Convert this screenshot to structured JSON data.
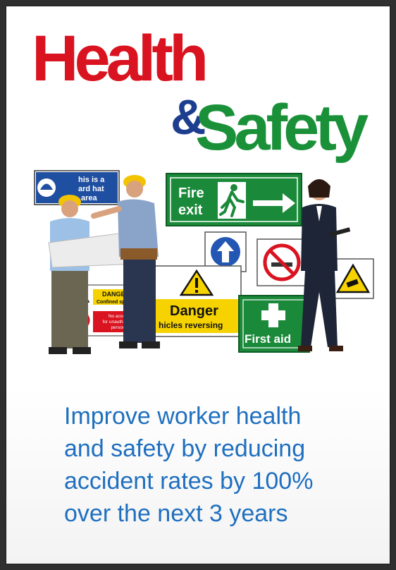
{
  "title": {
    "health": "Health",
    "amp": "&",
    "safety": "Safety"
  },
  "signs": {
    "hard_hat_line1": "his is a",
    "hard_hat_line2": "ard hat",
    "hard_hat_line3": "area",
    "fire_line1": "Fire",
    "fire_line2": "exit",
    "danger_small_title": "DANGER",
    "danger_small_sub": "Confined space",
    "no_access_line1": "No access",
    "no_access_line2": "for unauthorised",
    "no_access_line3": "persons",
    "danger_big": "Danger",
    "danger_big_sub": "hicles reversing",
    "first_aid": "First aid"
  },
  "tagline": {
    "line1": "Improve worker health",
    "line2": "and safety by reducing",
    "line3": "accident rates by 100%",
    "line4": "over the next 3 years"
  },
  "colors": {
    "health_red": "#d9131f",
    "amp_blue": "#1d3e8f",
    "safety_green": "#1a9138",
    "tagline_blue": "#1f6fbf"
  }
}
